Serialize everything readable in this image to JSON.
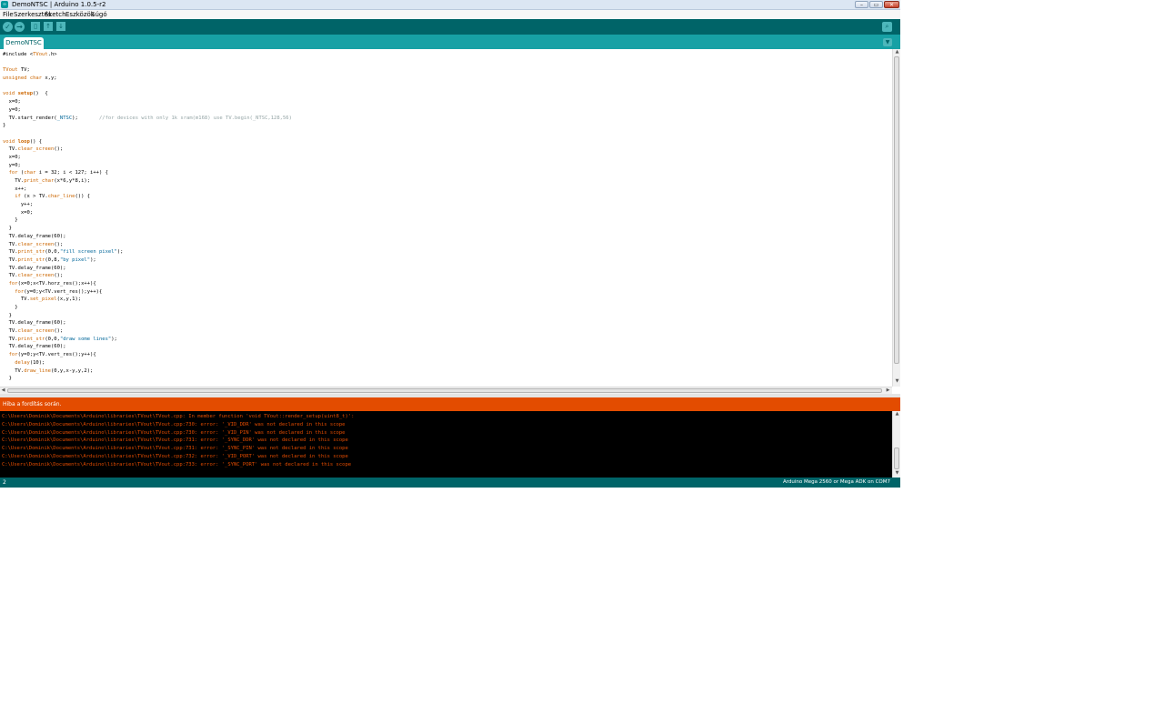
{
  "window": {
    "title": "DemoNTSC | Arduino 1.0.5-r2",
    "app_icon": "arduino-icon",
    "buttons": [
      "minimize-icon",
      "maximize-icon",
      "close-icon"
    ]
  },
  "menu": {
    "items": [
      "File",
      "Szerkesztés",
      "Sketch",
      "Eszközök",
      "Súgó"
    ]
  },
  "toolbar": {
    "verify_icon": "check-icon",
    "upload_icon": "arrow-right-icon",
    "new_icon": "new-file-icon",
    "open_icon": "open-arrow-up-icon",
    "save_icon": "save-arrow-down-icon",
    "serial_monitor_icon": "magnifier-icon",
    "verify_glyph": "✓",
    "upload_glyph": "→",
    "new_glyph": "▯",
    "open_glyph": "↑",
    "save_glyph": "↓",
    "serial_glyph": "⌕"
  },
  "tabs": {
    "active": "DemoNTSC",
    "menu_glyph": "▼"
  },
  "editor": {
    "lines": [
      "#include <TVout.h>",
      "",
      "TVout TV;",
      "unsigned char x,y;",
      "",
      "void setup()  {",
      "  x=0;",
      "  y=0;",
      "  TV.start_render(_NTSC);       //for devices with only 1k sram(m168) use TV.begin(_NTSC,128,56)",
      "}",
      "",
      "void loop() {",
      "  TV.clear_screen();",
      "  x=0;",
      "  y=0;",
      "  for (char i = 32; i < 127; i++) {",
      "    TV.print_char(x*6,y*8,i);",
      "    x++;",
      "    if (x > TV.char_line()) {",
      "      y++;",
      "      x=0;",
      "    }",
      "  }",
      "  TV.delay_frame(60);",
      "  TV.clear_screen();",
      "  TV.print_str(0,0,\"fill screen pixel\");",
      "  TV.print_str(0,8,\"by pixel\");",
      "  TV.delay_frame(60);",
      "  TV.clear_screen();",
      "  for(x=0;x<TV.horz_res();x++){",
      "    for(y=0;y<TV.vert_res();y++){",
      "      TV.set_pixel(x,y,1);",
      "    }",
      "  }",
      "  TV.delay_frame(60);",
      "  TV.clear_screen();",
      "  TV.print_str(0,0,\"draw some lines\");",
      "  TV.delay_frame(60);",
      "  for(y=0;y<TV.vert_res();y++){",
      "    delay(10);",
      "    TV.draw_line(0,y,x-y,y,2);",
      "  }"
    ]
  },
  "status": {
    "message": "Hiba a fordítás során."
  },
  "console": {
    "lines": [
      "C:\\Users\\Dominik\\Documents\\Arduino\\libraries\\TVout\\TVout.cpp: In member function 'void TVout::render_setup(uint8_t)':",
      "C:\\Users\\Dominik\\Documents\\Arduino\\libraries\\TVout\\TVout.cpp:730: error: '_VID_DDR' was not declared in this scope",
      "C:\\Users\\Dominik\\Documents\\Arduino\\libraries\\TVout\\TVout.cpp:730: error: '_VID_PIN' was not declared in this scope",
      "C:\\Users\\Dominik\\Documents\\Arduino\\libraries\\TVout\\TVout.cpp:731: error: '_SYNC_DDR' was not declared in this scope",
      "C:\\Users\\Dominik\\Documents\\Arduino\\libraries\\TVout\\TVout.cpp:731: error: '_SYNC_PIN' was not declared in this scope",
      "C:\\Users\\Dominik\\Documents\\Arduino\\libraries\\TVout\\TVout.cpp:732: error: '_VID_PORT' was not declared in this scope",
      "C:\\Users\\Dominik\\Documents\\Arduino\\libraries\\TVout\\TVout.cpp:733: error: '_SYNC_PORT' was not declared in this scope"
    ]
  },
  "footer": {
    "line_number": "2",
    "board": "Arduino Mega 2560 or Mega ADK on COM7"
  },
  "colors": {
    "toolbar": "#006468",
    "tab_bar": "#17a1a5",
    "error_bar": "#e34c00",
    "console_text": "#e34c00"
  }
}
